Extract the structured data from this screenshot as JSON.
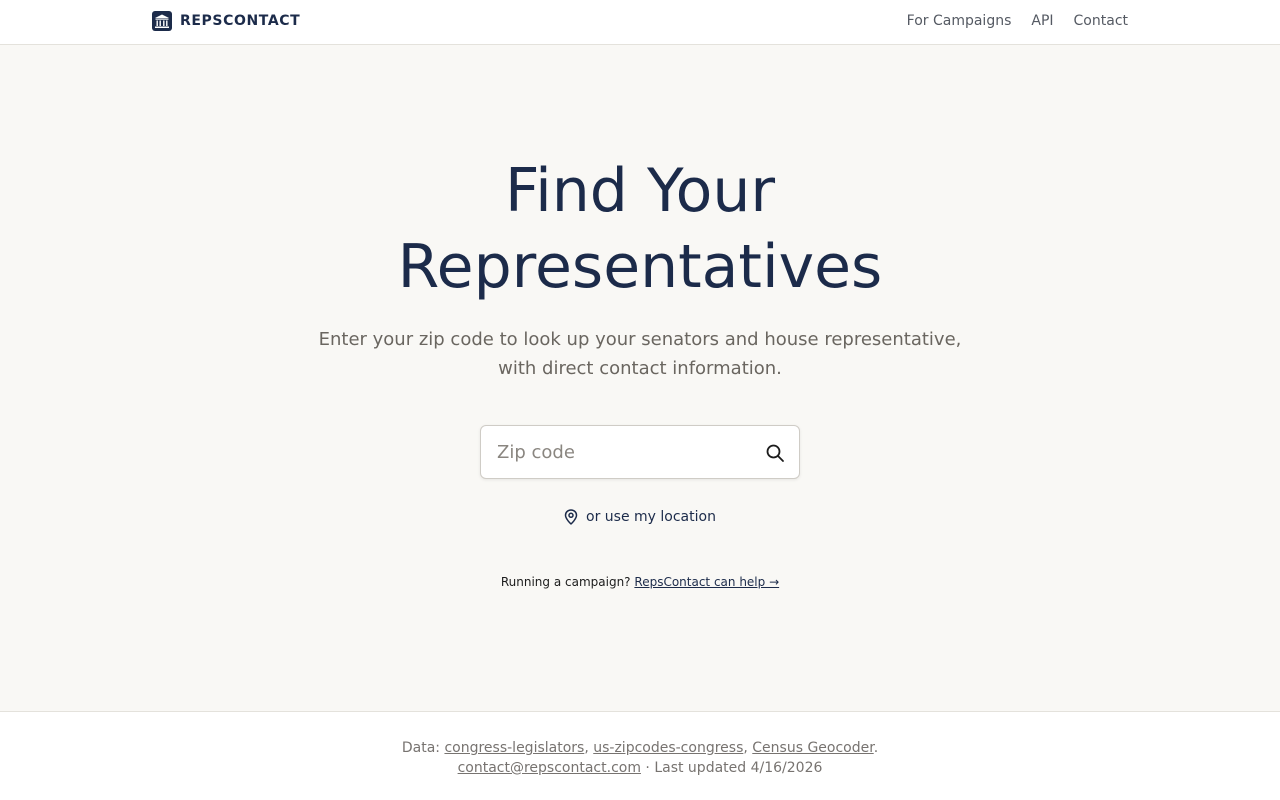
{
  "header": {
    "brand": "REPSCONTACT",
    "nav": [
      "For Campaigns",
      "API",
      "Contact"
    ]
  },
  "hero": {
    "title_line1": "Find Your",
    "title_line2": "Representatives",
    "subtitle_line1": "Enter your zip code to look up your senators and house representative,",
    "subtitle_line2": "with direct contact information.",
    "search_placeholder": "Zip code",
    "search_value": "",
    "location_label": "or use my location",
    "campaign_prefix": "Running a campaign?",
    "campaign_link": "RepsContact can help →"
  },
  "footer": {
    "data_prefix": "Data:",
    "sources": [
      "congress-legislators",
      "us-zipcodes-congress",
      "Census Geocoder"
    ],
    "sep": ",",
    "end": ".",
    "email": "contact@repscontact.com",
    "updated": "· Last updated 4/16/2026"
  },
  "icons": {
    "brand": "capitol-building-icon",
    "search": "search-icon",
    "location": "map-pin-icon"
  },
  "colors": {
    "primary": "#1c2b4a",
    "background": "#f9f8f5",
    "muted_text": "#6a6660"
  }
}
